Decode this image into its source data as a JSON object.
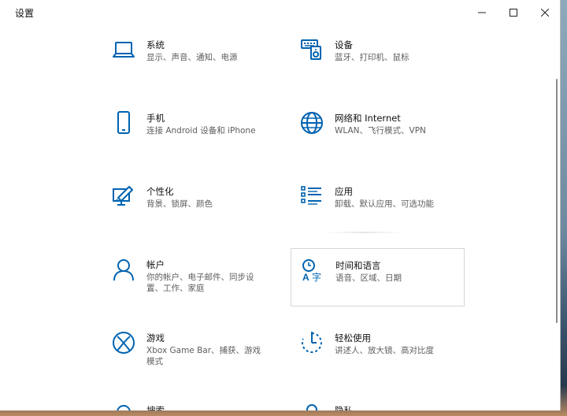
{
  "window": {
    "title": "设置",
    "controls": {
      "minimize": "minimize-icon",
      "maximize": "maximize-icon",
      "close": "close-icon"
    }
  },
  "colors": {
    "accent": "#0063b1",
    "title_text": "#111111",
    "subtitle_text": "#5d5d5d",
    "window_bg": "#ffffff"
  },
  "tiles": [
    {
      "id": "system",
      "icon": "laptop-icon",
      "title": "系统",
      "subtitle": "显示、声音、通知、电源"
    },
    {
      "id": "devices",
      "icon": "keyboard-speaker-icon",
      "title": "设备",
      "subtitle": "蓝牙、打印机、鼠标"
    },
    {
      "id": "phone",
      "icon": "phone-icon",
      "title": "手机",
      "subtitle": "连接 Android 设备和 iPhone"
    },
    {
      "id": "network",
      "icon": "globe-icon",
      "title": "网络和 Internet",
      "subtitle": "WLAN、飞行模式、VPN"
    },
    {
      "id": "personalization",
      "icon": "paint-brush-icon",
      "title": "个性化",
      "subtitle": "背景、锁屏、颜色"
    },
    {
      "id": "apps",
      "icon": "apps-list-icon",
      "title": "应用",
      "subtitle": "卸载、默认应用、可选功能"
    },
    {
      "id": "accounts",
      "icon": "person-icon",
      "title": "帐户",
      "subtitle": "你的帐户、电子邮件、同步设置、工作、家庭"
    },
    {
      "id": "time-language",
      "icon": "clock-language-icon",
      "title": "时间和语言",
      "subtitle": "语音、区域、日期"
    },
    {
      "id": "gaming",
      "icon": "xbox-icon",
      "title": "游戏",
      "subtitle": "Xbox Game Bar、捕获、游戏模式"
    },
    {
      "id": "ease-of-access",
      "icon": "accessibility-timer-icon",
      "title": "轻松使用",
      "subtitle": "讲述人、放大镜、高对比度"
    },
    {
      "id": "search",
      "icon": "search-icon",
      "title": "搜索",
      "subtitle": ""
    },
    {
      "id": "privacy",
      "icon": "lock-icon",
      "title": "隐私",
      "subtitle": ""
    }
  ]
}
